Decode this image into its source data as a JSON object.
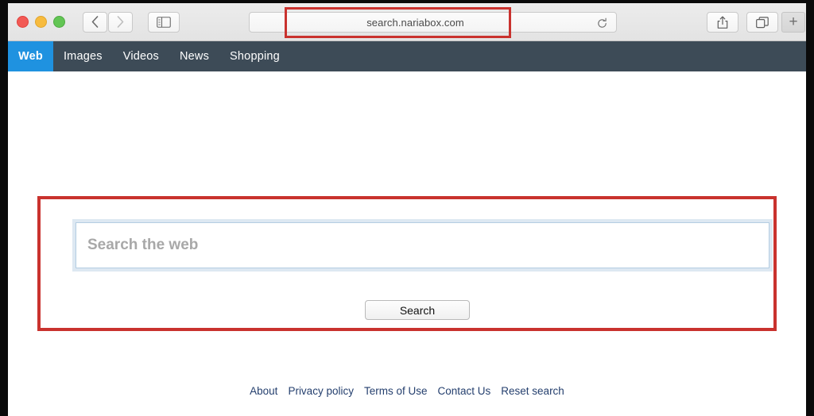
{
  "browser": {
    "url": "search.nariabox.com",
    "traffic_lights": {
      "close_label": "close",
      "minimize_label": "minimize",
      "maximize_label": "maximize"
    },
    "back_label": "Back",
    "forward_label": "Forward",
    "sidebar_label": "Show sidebar",
    "reload_label": "Reload",
    "share_label": "Share",
    "tabs_label": "Show tab overview",
    "new_tab_label": "+"
  },
  "site_nav": {
    "items": [
      {
        "label": "Web",
        "active": true
      },
      {
        "label": "Images",
        "active": false
      },
      {
        "label": "Videos",
        "active": false
      },
      {
        "label": "News",
        "active": false
      },
      {
        "label": "Shopping",
        "active": false
      }
    ]
  },
  "search": {
    "placeholder": "Search the web",
    "value": "",
    "button_label": "Search"
  },
  "footer": {
    "links": [
      {
        "label": "About"
      },
      {
        "label": "Privacy policy"
      },
      {
        "label": "Terms of Use"
      },
      {
        "label": "Contact Us"
      },
      {
        "label": "Reset search"
      }
    ]
  },
  "annotations": {
    "highlight_color": "#c9322e",
    "url_box_label": "url-highlight",
    "search_box_label": "search-area-highlight"
  },
  "colors": {
    "nav_bar": "#3d4b57",
    "nav_active": "#1f92e0",
    "link": "#243f6e",
    "toolbar": "#e8e8e8",
    "input_border": "#b4cde2"
  }
}
